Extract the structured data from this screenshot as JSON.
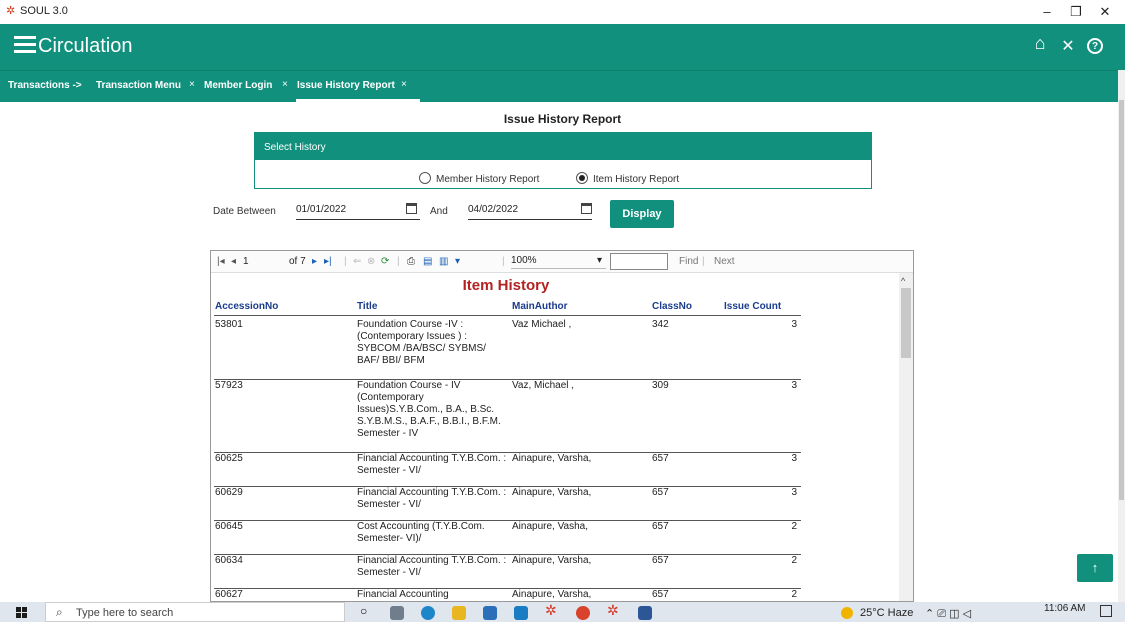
{
  "window": {
    "title": "SOUL 3.0",
    "minimize": "–",
    "restore": "❐",
    "close": "✕"
  },
  "header": {
    "title": "Circulation",
    "home_icon": "⌂",
    "close_icon": "✕",
    "help_icon": "?"
  },
  "tabs": [
    {
      "label": "Transactions ->",
      "closable": false
    },
    {
      "label": "Transaction Menu",
      "closable": true
    },
    {
      "label": "Member Login",
      "closable": true
    },
    {
      "label": "Issue History Report",
      "closable": true,
      "active": true
    }
  ],
  "tab_close": "×",
  "page": {
    "heading": "Issue History Report"
  },
  "history_panel": {
    "title": "Select History",
    "options": [
      "Member History Report",
      "Item History Report"
    ],
    "selected": "Item History Report"
  },
  "date_filter": {
    "label": "Date Between",
    "from": "01/01/2022",
    "and_label": "And",
    "to": "04/02/2022",
    "button": "Display"
  },
  "report_toolbar": {
    "page": "1",
    "of_pages": "of 7",
    "zoom": "100%",
    "find": "Find",
    "next": "Next",
    "separator": "|"
  },
  "report": {
    "title": "Item History",
    "columns": [
      "AccessionNo",
      "Title",
      "MainAuthor",
      "ClassNo",
      "Issue Count"
    ],
    "rows": [
      {
        "accession": "53801",
        "title": "Foundation Course -IV : (Contemporary Issues ) : SYBCOM /BA/BSC/ SYBMS/ BAF/ BBI/ BFM",
        "author": "Vaz Michael ,",
        "classno": "342",
        "count": "3"
      },
      {
        "accession": "57923",
        "title": "Foundation Course - IV (Contemporary Issues)S.Y.B.Com., B.A., B.Sc. S.Y.B.M.S., B.A.F., B.B.I., B.F.M. Semester - IV",
        "author": "Vaz, Michael ,",
        "classno": "309",
        "count": "3"
      },
      {
        "accession": "60625",
        "title": "Financial Accounting T.Y.B.Com. : Semester - VI/",
        "author": "Ainapure, Varsha,",
        "classno": "657",
        "count": "3"
      },
      {
        "accession": "60629",
        "title": "Financial Accounting T.Y.B.Com. : Semester - VI/",
        "author": "Ainapure, Varsha,",
        "classno": "657",
        "count": "3"
      },
      {
        "accession": "60645",
        "title": "Cost Accounting (T.Y.B.Com. Semester- VI)/",
        "author": "Ainapure, Vasha,",
        "classno": "657",
        "count": "2"
      },
      {
        "accession": "60634",
        "title": "Financial Accounting T.Y.B.Com. : Semester - VI/",
        "author": "Ainapure, Varsha,",
        "classno": "657",
        "count": "2"
      },
      {
        "accession": "60627",
        "title": "Financial Accounting",
        "author": "Ainapure, Varsha,",
        "classno": "657",
        "count": "2"
      }
    ]
  },
  "scroll_top": "↑",
  "taskbar": {
    "search_placeholder": "Type here to search",
    "weather": "25°C Haze",
    "time": "11:06 AM"
  },
  "colors": {
    "accent": "#11917d",
    "report_title": "#b22222",
    "column_header": "#1a3c8c"
  }
}
